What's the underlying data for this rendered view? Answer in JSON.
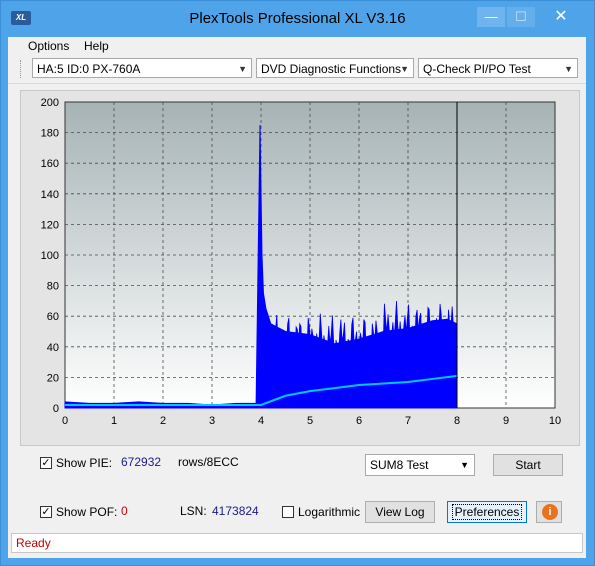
{
  "window": {
    "title": "PlexTools Professional XL V3.16",
    "icon_label": "XL",
    "controls": {
      "minimize": "—",
      "maximize": "☐",
      "close": "✕"
    }
  },
  "menu": {
    "options_label": "Options",
    "help_label": "Help"
  },
  "toolbar": {
    "drive_select": "HA:5 ID:0  PX-760A",
    "function_select": "DVD Diagnostic Functions",
    "test_select": "Q-Check PI/PO Test"
  },
  "chart_data": {
    "type": "area",
    "xlim": [
      0,
      10
    ],
    "ylim": [
      0,
      200
    ],
    "x_ticks": [
      "0",
      "1",
      "2",
      "3",
      "4",
      "5",
      "6",
      "7",
      "8",
      "9",
      "10"
    ],
    "y_ticks": [
      "0",
      "20",
      "40",
      "60",
      "80",
      "100",
      "120",
      "140",
      "160",
      "180",
      "200"
    ],
    "grid": true,
    "series": [
      {
        "color": "#0000ff",
        "x": [
          0,
          0.5,
          1,
          1.5,
          2,
          2.5,
          3,
          3.5,
          3.9,
          3.98,
          4.02,
          4.05,
          4.1,
          4.2,
          4.5,
          5,
          5.5,
          6,
          6.5,
          7,
          7.5,
          7.8,
          8
        ],
        "y": [
          4,
          3,
          3,
          4,
          3,
          3,
          2,
          3,
          3,
          185,
          100,
          75,
          65,
          55,
          50,
          48,
          42,
          45,
          50,
          52,
          57,
          58,
          55
        ]
      },
      {
        "color": "#00c8ff",
        "x": [
          0,
          1,
          2,
          3,
          3.95,
          4,
          4.5,
          5,
          5.5,
          6,
          6.5,
          7,
          7.5,
          8
        ],
        "y": [
          2,
          2,
          2,
          2,
          2,
          2,
          8,
          11,
          13,
          15,
          16,
          17,
          19,
          21
        ]
      }
    ],
    "marker_x": 8
  },
  "controls": {
    "show_pie_label": "Show PIE:",
    "show_pie_checked": "✓",
    "pie_value": "672932",
    "pie_unit": "rows/8ECC",
    "show_poe_label": "Show POF:",
    "show_poe_checked": "✓",
    "poe_value": "0",
    "lsn_label": "LSN:",
    "lsn_value": "4173824",
    "log_label": "Logarithmic",
    "test_select": "SUM8 Test",
    "start_label": "Start",
    "viewlog_label": "View Log",
    "preferences_label": "Preferences",
    "info_icon": "i"
  },
  "status": {
    "text": "Ready"
  }
}
